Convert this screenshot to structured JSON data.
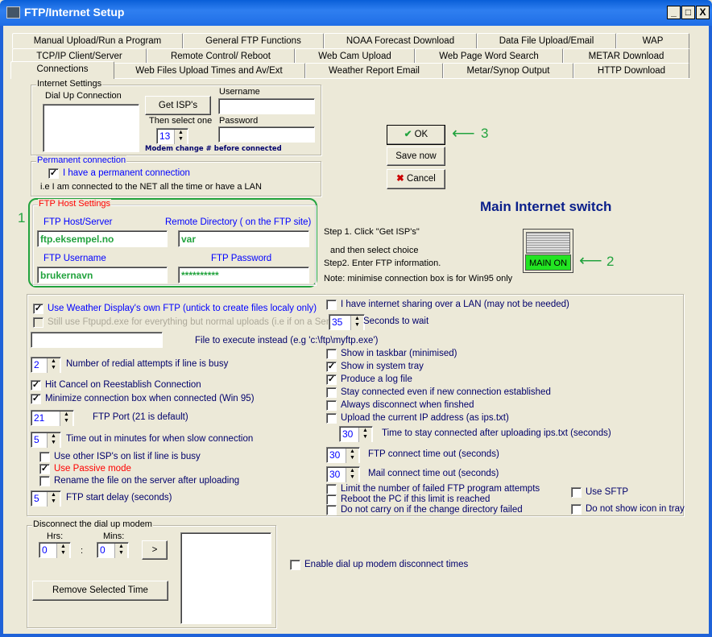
{
  "window": {
    "title": "FTP/Internet Setup",
    "min": "_",
    "max": "□",
    "close": "X"
  },
  "tabs": {
    "row1": [
      "Manual Upload/Run a Program",
      "General FTP Functions",
      "NOAA Forecast Download",
      "Data File Upload/Email",
      "WAP"
    ],
    "row2": [
      "TCP/IP Client/Server",
      "Remote Control/ Reboot",
      "Web Cam Upload",
      "Web Page Word Search",
      "METAR Download"
    ],
    "row3": [
      "Connections",
      "Web Files Upload Times and  Av/Ext",
      "Weather Report Email",
      "Metar/Synop Output",
      "HTTP Download"
    ],
    "selected": "Connections"
  },
  "internet": {
    "legend": "Internet Settings",
    "dialup": "Dial Up Connection",
    "get_isps": "Get ISP's",
    "then_select": "Then select one",
    "username": "Username",
    "password": "Password",
    "modem_value": "13",
    "modem_note": "Modem change # before connected"
  },
  "permanent": {
    "legend": "Permanent connection",
    "note": "i.e I am connected to the NET all the time or have a LAN"
  },
  "ftp_host": {
    "legend": "FTP Host Settings",
    "host_label": "FTP Host/Server",
    "host": "ftp.eksempel.no",
    "dir_label": "Remote Directory ( on the FTP site)",
    "dir": "var",
    "user_label": "FTP Username",
    "user": "brukernavn",
    "pass_label": "FTP Password",
    "pass": "**********"
  },
  "buttons": {
    "ok": "OK",
    "save": "Save now",
    "cancel": "Cancel"
  },
  "annotations": {
    "one": "1",
    "two": "2",
    "three": "3",
    "color": "#22a33e"
  },
  "switch": {
    "title": "Main Internet switch",
    "label": "MAIN ON",
    "state": "on",
    "color": "#22e422"
  },
  "steps": [
    "Step 1. Click  \"Get ISP's\"",
    "and then select choice",
    "Step2. Enter FTP information.",
    "Note: minimise connection box is for Win95 only"
  ],
  "checkboxes": [
    {
      "label": "I have a permanent connection",
      "checked": true,
      "color": "blue"
    },
    {
      "label": "Use Weather Display's own FTP  (untick to create files localy only)",
      "checked": true,
      "color": "blue"
    },
    {
      "label": "Still use Ftpupd.exe for everything but normal uploads (i.e if on a Server)",
      "checked": false,
      "disabled": true
    },
    {
      "label": "Hit Cancel on Reestablish Connection",
      "checked": true
    },
    {
      "label": "Minimize connection box when connected (Win 95)",
      "checked": true
    },
    {
      "label": "Use other ISP's on list if line is busy",
      "checked": false
    },
    {
      "label": "Use Passive mode",
      "checked": true,
      "color": "red"
    },
    {
      "label": "Rename the file on the server after uploading",
      "checked": false
    },
    {
      "label": "I have internet sharing over a LAN (may not be needed)",
      "checked": false
    },
    {
      "label": "Show in taskbar (minimised)",
      "checked": false
    },
    {
      "label": "Show in system tray",
      "checked": true
    },
    {
      "label": "Produce a log file",
      "checked": true
    },
    {
      "label": "Stay connected even if new connection established",
      "checked": false
    },
    {
      "label": "Always disconnect when finshed",
      "checked": false
    },
    {
      "label": "Upload the current IP address (as ips.txt)",
      "checked": false
    },
    {
      "label": "Limit the number of failed FTP program attempts",
      "checked": false
    },
    {
      "label": "Reboot the PC if this limit is reached",
      "checked": false
    },
    {
      "label": "Do not carry on if the change directory failed",
      "checked": false
    },
    {
      "label": "Use SFTP",
      "checked": false
    },
    {
      "label": "Do not show icon in tray",
      "checked": false
    },
    {
      "label": "Enable dial up modem disconnect times",
      "checked": false
    }
  ],
  "spinners": [
    {
      "value": "35",
      "label": "Seconds to wait"
    },
    {
      "value": "2",
      "label": "Number of redial attempts if line is busy"
    },
    {
      "value": "21",
      "label": "FTP Port (21 is default)"
    },
    {
      "value": "5",
      "label": "Time out in minutes for when slow connection"
    },
    {
      "value": "30",
      "label": "Time to stay connected after uploading ips.txt (seconds)"
    },
    {
      "value": "30",
      "label": "FTP connect time out (seconds)"
    },
    {
      "value": "30",
      "label": "Mail connect time out (seconds)"
    },
    {
      "value": "5",
      "label": "FTP start delay (seconds)"
    },
    {
      "value": "0",
      "label": ""
    },
    {
      "value": "0",
      "label": ""
    }
  ],
  "exec": {
    "label": "File to execute instead (e.g 'c:\\ftp\\myftp.exe')",
    "value": ""
  },
  "disconnect": {
    "legend": "Disconnect the dial up modem",
    "hrs": "Hrs:",
    "mins": "Mins:",
    "colon": ":",
    "add": ">",
    "remove": "Remove Selected Time"
  }
}
